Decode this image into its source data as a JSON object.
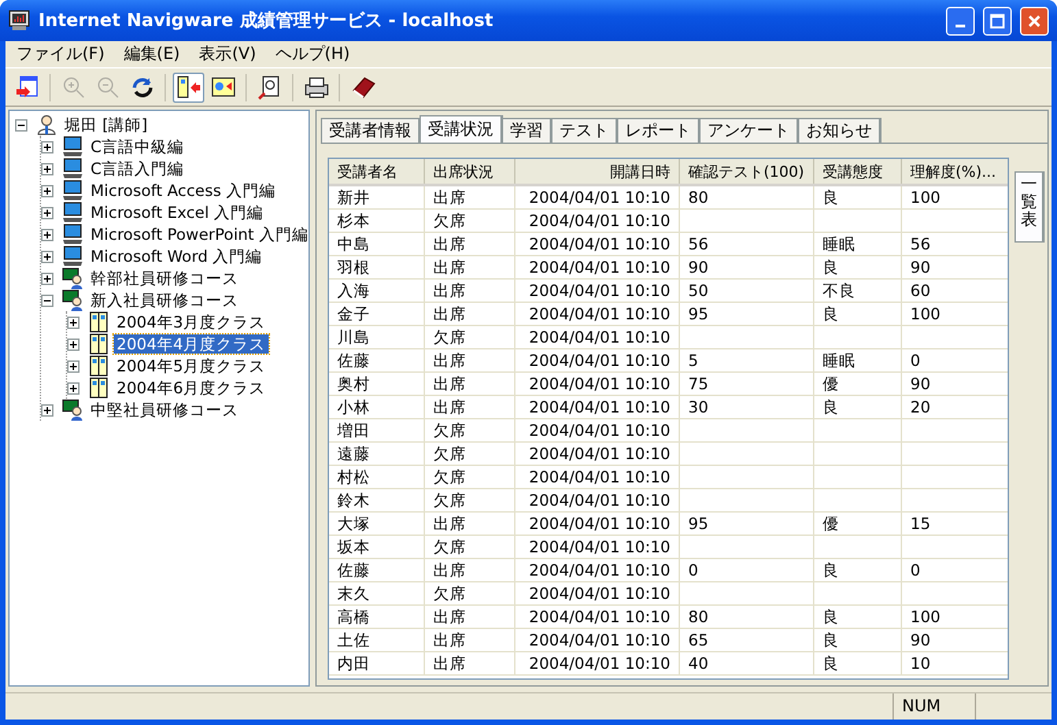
{
  "window": {
    "title": "Internet Navigware 成績管理サービス - localhost"
  },
  "menu": [
    "ファイル(F)",
    "編集(E)",
    "表示(V)",
    "ヘルプ(H)"
  ],
  "toolbar": [
    {
      "kind": "exit",
      "disabled": false,
      "pressed": false
    },
    {
      "kind": "sep"
    },
    {
      "kind": "zoom-in",
      "disabled": true,
      "pressed": false
    },
    {
      "kind": "zoom-out",
      "disabled": true,
      "pressed": false
    },
    {
      "kind": "refresh",
      "disabled": false,
      "pressed": false
    },
    {
      "kind": "sep"
    },
    {
      "kind": "view-a",
      "disabled": false,
      "pressed": true
    },
    {
      "kind": "view-b",
      "disabled": false,
      "pressed": false
    },
    {
      "kind": "sep"
    },
    {
      "kind": "find",
      "disabled": false,
      "pressed": false
    },
    {
      "kind": "sep"
    },
    {
      "kind": "print",
      "disabled": false,
      "pressed": false
    },
    {
      "kind": "sep"
    },
    {
      "kind": "book",
      "disabled": false,
      "pressed": false
    }
  ],
  "tree": [
    {
      "label": "堀田 [講師]",
      "kind": "instructor",
      "expanded": true,
      "selected": false,
      "children": [
        {
          "label": "C言語中級編",
          "kind": "computer",
          "expanded": false,
          "selected": false
        },
        {
          "label": "C言語入門編",
          "kind": "computer",
          "expanded": false,
          "selected": false
        },
        {
          "label": "Microsoft Access 入門編",
          "kind": "computer",
          "expanded": false,
          "selected": false
        },
        {
          "label": "Microsoft Excel 入門編",
          "kind": "computer",
          "expanded": false,
          "selected": false
        },
        {
          "label": "Microsoft PowerPoint 入門編",
          "kind": "computer",
          "expanded": false,
          "selected": false
        },
        {
          "label": "Microsoft Word 入門編",
          "kind": "computer",
          "expanded": false,
          "selected": false
        },
        {
          "label": "幹部社員研修コース",
          "kind": "course",
          "expanded": false,
          "selected": false
        },
        {
          "label": "新入社員研修コース",
          "kind": "course",
          "expanded": true,
          "selected": false,
          "children": [
            {
              "label": "2004年3月度クラス",
              "kind": "class",
              "expanded": false,
              "selected": false
            },
            {
              "label": "2004年4月度クラス",
              "kind": "class",
              "expanded": false,
              "selected": true
            },
            {
              "label": "2004年5月度クラス",
              "kind": "class",
              "expanded": false,
              "selected": false
            },
            {
              "label": "2004年6月度クラス",
              "kind": "class",
              "expanded": false,
              "selected": false
            }
          ]
        },
        {
          "label": "中堅社員研修コース",
          "kind": "course",
          "expanded": false,
          "selected": false
        }
      ]
    }
  ],
  "tabs": [
    {
      "label": "受講者情報",
      "selected": false
    },
    {
      "label": "受講状況",
      "selected": true
    },
    {
      "label": "学習",
      "selected": false
    },
    {
      "label": "テスト",
      "selected": false
    },
    {
      "label": "レポート",
      "selected": false
    },
    {
      "label": "アンケート",
      "selected": false
    },
    {
      "label": "お知らせ",
      "selected": false
    }
  ],
  "side_tab": {
    "label": "一覧表",
    "selected": true
  },
  "table": {
    "columns": [
      "受講者名",
      "出席状況",
      "開講日時",
      "確認テスト(100)",
      "受講態度",
      "理解度(%)..."
    ],
    "rows": [
      [
        "新井",
        "出席",
        "2004/04/01 10:10",
        "80",
        "良",
        "100"
      ],
      [
        "杉本",
        "欠席",
        "2004/04/01 10:10",
        "",
        "",
        ""
      ],
      [
        "中島",
        "出席",
        "2004/04/01 10:10",
        "56",
        "睡眠",
        "56"
      ],
      [
        "羽根",
        "出席",
        "2004/04/01 10:10",
        "90",
        "良",
        "90"
      ],
      [
        "入海",
        "出席",
        "2004/04/01 10:10",
        "50",
        "不良",
        "60"
      ],
      [
        "金子",
        "出席",
        "2004/04/01 10:10",
        "95",
        "良",
        "100"
      ],
      [
        "川島",
        "欠席",
        "2004/04/01 10:10",
        "",
        "",
        ""
      ],
      [
        "佐藤",
        "出席",
        "2004/04/01 10:10",
        "5",
        "睡眠",
        "0"
      ],
      [
        "奥村",
        "出席",
        "2004/04/01 10:10",
        "75",
        "優",
        "90"
      ],
      [
        "小林",
        "出席",
        "2004/04/01 10:10",
        "30",
        "良",
        "20"
      ],
      [
        "増田",
        "欠席",
        "2004/04/01 10:10",
        "",
        "",
        ""
      ],
      [
        "遠藤",
        "欠席",
        "2004/04/01 10:10",
        "",
        "",
        ""
      ],
      [
        "村松",
        "欠席",
        "2004/04/01 10:10",
        "",
        "",
        ""
      ],
      [
        "鈴木",
        "欠席",
        "2004/04/01 10:10",
        "",
        "",
        ""
      ],
      [
        "大塚",
        "出席",
        "2004/04/01 10:10",
        "95",
        "優",
        "15"
      ],
      [
        "坂本",
        "欠席",
        "2004/04/01 10:10",
        "",
        "",
        ""
      ],
      [
        "佐藤",
        "出席",
        "2004/04/01 10:10",
        "0",
        "良",
        "0"
      ],
      [
        "末久",
        "欠席",
        "2004/04/01 10:10",
        "",
        "",
        ""
      ],
      [
        "高橋",
        "出席",
        "2004/04/01 10:10",
        "80",
        "良",
        "100"
      ],
      [
        "土佐",
        "出席",
        "2004/04/01 10:10",
        "65",
        "良",
        "90"
      ],
      [
        "内田",
        "出席",
        "2004/04/01 10:10",
        "40",
        "良",
        "10"
      ]
    ]
  },
  "status_bar": [
    "NUM"
  ]
}
